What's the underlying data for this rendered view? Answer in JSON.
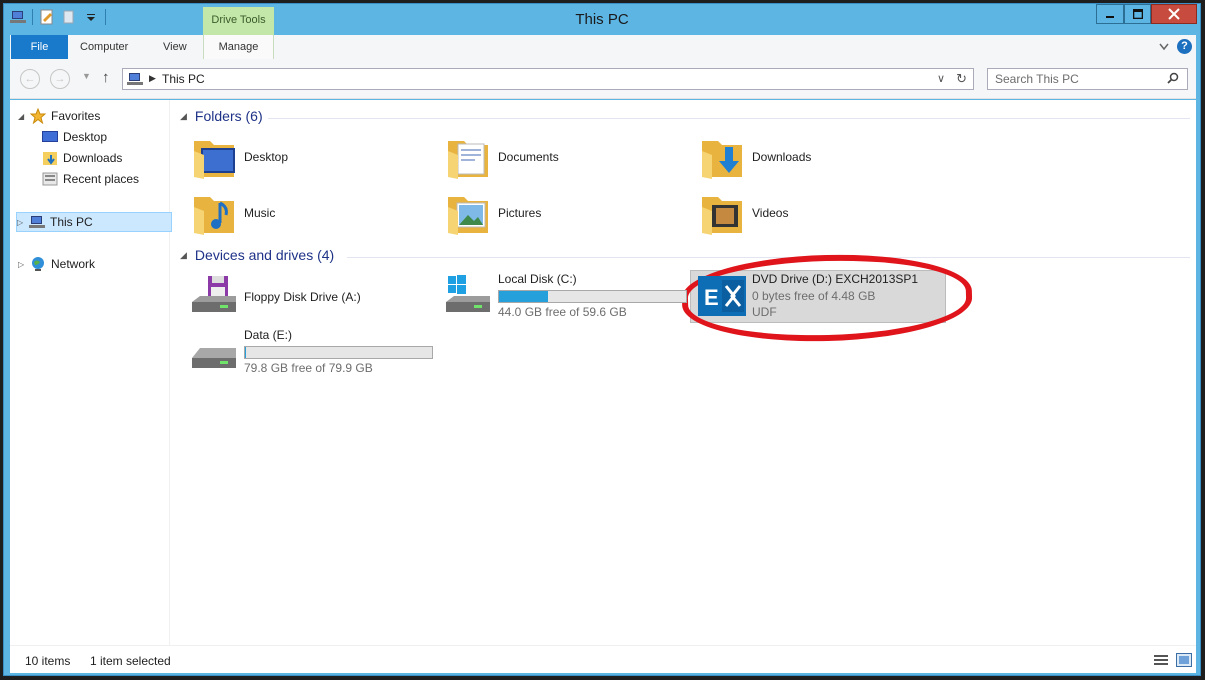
{
  "window": {
    "title": "This PC"
  },
  "ribbon": {
    "contextual_tab": "Drive Tools",
    "tabs": {
      "file": "File",
      "computer": "Computer",
      "view": "View",
      "manage": "Manage"
    },
    "help": "?"
  },
  "navigation": {
    "address_path": "This PC",
    "search_placeholder": "Search This PC"
  },
  "sidebar": {
    "favorites": "Favorites",
    "desktop": "Desktop",
    "downloads": "Downloads",
    "recent": "Recent places",
    "this_pc": "This PC",
    "network": "Network"
  },
  "main": {
    "folders_header": "Folders (6)",
    "folders": {
      "desktop": "Desktop",
      "documents": "Documents",
      "downloads": "Downloads",
      "music": "Music",
      "pictures": "Pictures",
      "videos": "Videos"
    },
    "devices_header": "Devices and drives (4)",
    "drives": {
      "floppy": {
        "name": "Floppy Disk Drive (A:)"
      },
      "local_c": {
        "name": "Local Disk (C:)",
        "free": "44.0 GB free of 59.6 GB",
        "used_fraction": 0.26
      },
      "dvd_d": {
        "name": "DVD Drive (D:) EXCH2013SP1",
        "free": "0 bytes free of 4.48 GB",
        "fs": "UDF",
        "logo": "E"
      },
      "data_e": {
        "name": "Data (E:)",
        "free": "79.8 GB free of 79.9 GB",
        "used_fraction": 0.001
      }
    }
  },
  "status": {
    "items": "10 items",
    "selected": "1 item selected"
  },
  "colors": {
    "title_bar": "#5db5e4",
    "file_tab": "#1979ca",
    "contextual_tab": "#c3e7a8",
    "header_text": "#1e3287",
    "annotation_ring": "#e0141b",
    "exchange_blue": "#0d6eb6"
  }
}
